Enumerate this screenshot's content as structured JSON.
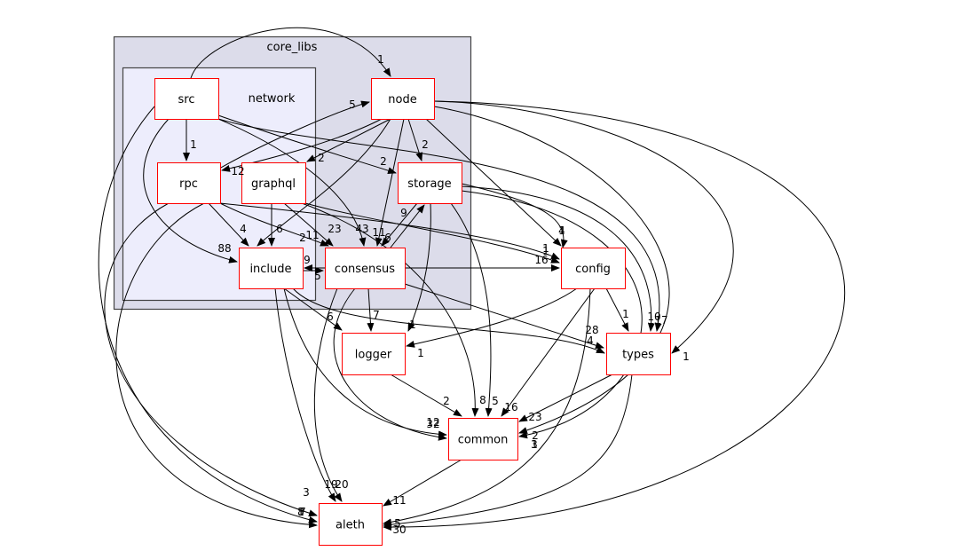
{
  "clusters": {
    "outer": {
      "label": "core_libs",
      "fill": "#dcdcea"
    },
    "inner": {
      "label": "network",
      "fill": "#ededfc"
    }
  },
  "nodes": {
    "src": "src",
    "node": "node",
    "rpc": "rpc",
    "graphql": "graphql",
    "storage": "storage",
    "include": "include",
    "consensus": "consensus",
    "config": "config",
    "logger": "logger",
    "types": "types",
    "common": "common",
    "aleth": "aleth"
  },
  "colors": {
    "node_border": "#ff0000",
    "edge": "#000000"
  },
  "edge_labels": [
    "1",
    "5",
    "1",
    "12",
    "2",
    "2",
    "2",
    "4",
    "6",
    "88",
    "2",
    "11",
    "23",
    "43",
    "11",
    "6",
    "9",
    "9",
    "5",
    "4",
    "1",
    "1",
    "1",
    "16",
    "6",
    "7",
    "1",
    "1",
    "1",
    "10",
    "17",
    "28",
    "4",
    "1",
    "2",
    "8",
    "5",
    "16",
    "23",
    "12",
    "32",
    "2",
    "1",
    "3",
    "3",
    "19",
    "20",
    "11",
    "1",
    "8",
    "7",
    "5",
    "30"
  ]
}
